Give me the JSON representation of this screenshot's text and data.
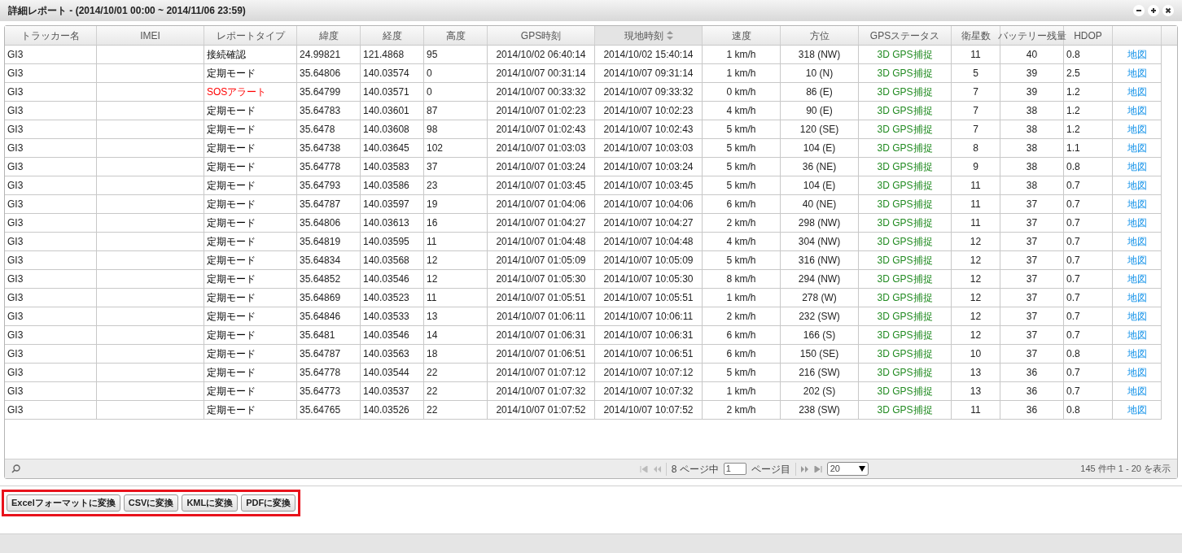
{
  "window": {
    "title": "詳細レポート - (2014/10/01 00:00 ~ 2014/11/06 23:59)"
  },
  "table": {
    "columns": [
      {
        "label": "トラッカー名",
        "sorted": false
      },
      {
        "label": "IMEI",
        "sorted": false
      },
      {
        "label": "レポートタイプ",
        "sorted": false
      },
      {
        "label": "緯度",
        "sorted": false
      },
      {
        "label": "経度",
        "sorted": false
      },
      {
        "label": "高度",
        "sorted": false
      },
      {
        "label": "GPS時刻",
        "sorted": false
      },
      {
        "label": "現地時刻",
        "sorted": true
      },
      {
        "label": "速度",
        "sorted": false
      },
      {
        "label": "方位",
        "sorted": false
      },
      {
        "label": "GPSステータス",
        "sorted": false
      },
      {
        "label": "衛星数",
        "sorted": false
      },
      {
        "label": "バッテリー残量",
        "sorted": false
      },
      {
        "label": "HDOP",
        "sorted": false
      }
    ],
    "rows": [
      {
        "alert": false,
        "cells": [
          "GI3",
          "",
          "接続確認",
          "24.99821",
          "121.4868",
          "95",
          "2014/10/02 06:40:14",
          "2014/10/02 15:40:14",
          "1 km/h",
          "318 (NW)",
          "3D GPS捕捉",
          "11",
          "40",
          "0.8",
          "地図"
        ]
      },
      {
        "alert": false,
        "cells": [
          "GI3",
          "",
          "定期モード",
          "35.64806",
          "140.03574",
          "0",
          "2014/10/07 00:31:14",
          "2014/10/07 09:31:14",
          "1 km/h",
          "10 (N)",
          "3D GPS捕捉",
          "5",
          "39",
          "2.5",
          "地図"
        ]
      },
      {
        "alert": true,
        "cells": [
          "GI3",
          "",
          "SOSアラート",
          "35.64799",
          "140.03571",
          "0",
          "2014/10/07 00:33:32",
          "2014/10/07 09:33:32",
          "0 km/h",
          "86 (E)",
          "3D GPS捕捉",
          "7",
          "39",
          "1.2",
          "地図"
        ]
      },
      {
        "alert": false,
        "cells": [
          "GI3",
          "",
          "定期モード",
          "35.64783",
          "140.03601",
          "87",
          "2014/10/07 01:02:23",
          "2014/10/07 10:02:23",
          "4 km/h",
          "90 (E)",
          "3D GPS捕捉",
          "7",
          "38",
          "1.2",
          "地図"
        ]
      },
      {
        "alert": false,
        "cells": [
          "GI3",
          "",
          "定期モード",
          "35.6478",
          "140.03608",
          "98",
          "2014/10/07 01:02:43",
          "2014/10/07 10:02:43",
          "5 km/h",
          "120 (SE)",
          "3D GPS捕捉",
          "7",
          "38",
          "1.2",
          "地図"
        ]
      },
      {
        "alert": false,
        "cells": [
          "GI3",
          "",
          "定期モード",
          "35.64738",
          "140.03645",
          "102",
          "2014/10/07 01:03:03",
          "2014/10/07 10:03:03",
          "5 km/h",
          "104 (E)",
          "3D GPS捕捉",
          "8",
          "38",
          "1.1",
          "地図"
        ]
      },
      {
        "alert": false,
        "cells": [
          "GI3",
          "",
          "定期モード",
          "35.64778",
          "140.03583",
          "37",
          "2014/10/07 01:03:24",
          "2014/10/07 10:03:24",
          "5 km/h",
          "36 (NE)",
          "3D GPS捕捉",
          "9",
          "38",
          "0.8",
          "地図"
        ]
      },
      {
        "alert": false,
        "cells": [
          "GI3",
          "",
          "定期モード",
          "35.64793",
          "140.03586",
          "23",
          "2014/10/07 01:03:45",
          "2014/10/07 10:03:45",
          "5 km/h",
          "104 (E)",
          "3D GPS捕捉",
          "11",
          "38",
          "0.7",
          "地図"
        ]
      },
      {
        "alert": false,
        "cells": [
          "GI3",
          "",
          "定期モード",
          "35.64787",
          "140.03597",
          "19",
          "2014/10/07 01:04:06",
          "2014/10/07 10:04:06",
          "6 km/h",
          "40 (NE)",
          "3D GPS捕捉",
          "11",
          "37",
          "0.7",
          "地図"
        ]
      },
      {
        "alert": false,
        "cells": [
          "GI3",
          "",
          "定期モード",
          "35.64806",
          "140.03613",
          "16",
          "2014/10/07 01:04:27",
          "2014/10/07 10:04:27",
          "2 km/h",
          "298 (NW)",
          "3D GPS捕捉",
          "11",
          "37",
          "0.7",
          "地図"
        ]
      },
      {
        "alert": false,
        "cells": [
          "GI3",
          "",
          "定期モード",
          "35.64819",
          "140.03595",
          "11",
          "2014/10/07 01:04:48",
          "2014/10/07 10:04:48",
          "4 km/h",
          "304 (NW)",
          "3D GPS捕捉",
          "12",
          "37",
          "0.7",
          "地図"
        ]
      },
      {
        "alert": false,
        "cells": [
          "GI3",
          "",
          "定期モード",
          "35.64834",
          "140.03568",
          "12",
          "2014/10/07 01:05:09",
          "2014/10/07 10:05:09",
          "5 km/h",
          "316 (NW)",
          "3D GPS捕捉",
          "12",
          "37",
          "0.7",
          "地図"
        ]
      },
      {
        "alert": false,
        "cells": [
          "GI3",
          "",
          "定期モード",
          "35.64852",
          "140.03546",
          "12",
          "2014/10/07 01:05:30",
          "2014/10/07 10:05:30",
          "8 km/h",
          "294 (NW)",
          "3D GPS捕捉",
          "12",
          "37",
          "0.7",
          "地図"
        ]
      },
      {
        "alert": false,
        "cells": [
          "GI3",
          "",
          "定期モード",
          "35.64869",
          "140.03523",
          "11",
          "2014/10/07 01:05:51",
          "2014/10/07 10:05:51",
          "1 km/h",
          "278 (W)",
          "3D GPS捕捉",
          "12",
          "37",
          "0.7",
          "地図"
        ]
      },
      {
        "alert": false,
        "cells": [
          "GI3",
          "",
          "定期モード",
          "35.64846",
          "140.03533",
          "13",
          "2014/10/07 01:06:11",
          "2014/10/07 10:06:11",
          "2 km/h",
          "232 (SW)",
          "3D GPS捕捉",
          "12",
          "37",
          "0.7",
          "地図"
        ]
      },
      {
        "alert": false,
        "cells": [
          "GI3",
          "",
          "定期モード",
          "35.6481",
          "140.03546",
          "14",
          "2014/10/07 01:06:31",
          "2014/10/07 10:06:31",
          "6 km/h",
          "166 (S)",
          "3D GPS捕捉",
          "12",
          "37",
          "0.7",
          "地図"
        ]
      },
      {
        "alert": false,
        "cells": [
          "GI3",
          "",
          "定期モード",
          "35.64787",
          "140.03563",
          "18",
          "2014/10/07 01:06:51",
          "2014/10/07 10:06:51",
          "6 km/h",
          "150 (SE)",
          "3D GPS捕捉",
          "10",
          "37",
          "0.8",
          "地図"
        ]
      },
      {
        "alert": false,
        "cells": [
          "GI3",
          "",
          "定期モード",
          "35.64778",
          "140.03544",
          "22",
          "2014/10/07 01:07:12",
          "2014/10/07 10:07:12",
          "5 km/h",
          "216 (SW)",
          "3D GPS捕捉",
          "13",
          "36",
          "0.7",
          "地図"
        ]
      },
      {
        "alert": false,
        "cells": [
          "GI3",
          "",
          "定期モード",
          "35.64773",
          "140.03537",
          "22",
          "2014/10/07 01:07:32",
          "2014/10/07 10:07:32",
          "1 km/h",
          "202 (S)",
          "3D GPS捕捉",
          "13",
          "36",
          "0.7",
          "地図"
        ]
      },
      {
        "alert": false,
        "cells": [
          "GI3",
          "",
          "定期モード",
          "35.64765",
          "140.03526",
          "22",
          "2014/10/07 01:07:52",
          "2014/10/07 10:07:52",
          "2 km/h",
          "238 (SW)",
          "3D GPS捕捉",
          "11",
          "36",
          "0.8",
          "地図"
        ]
      }
    ]
  },
  "pager": {
    "page_total": "8 ページ中",
    "page": "1",
    "page_suffix": "ページ目",
    "page_size": "20",
    "summary": "145 件中 1 - 20 を表示"
  },
  "buttons": [
    "Excelフォーマットに変換",
    "CSVに変換",
    "KMLに変換",
    "PDFに変換"
  ]
}
